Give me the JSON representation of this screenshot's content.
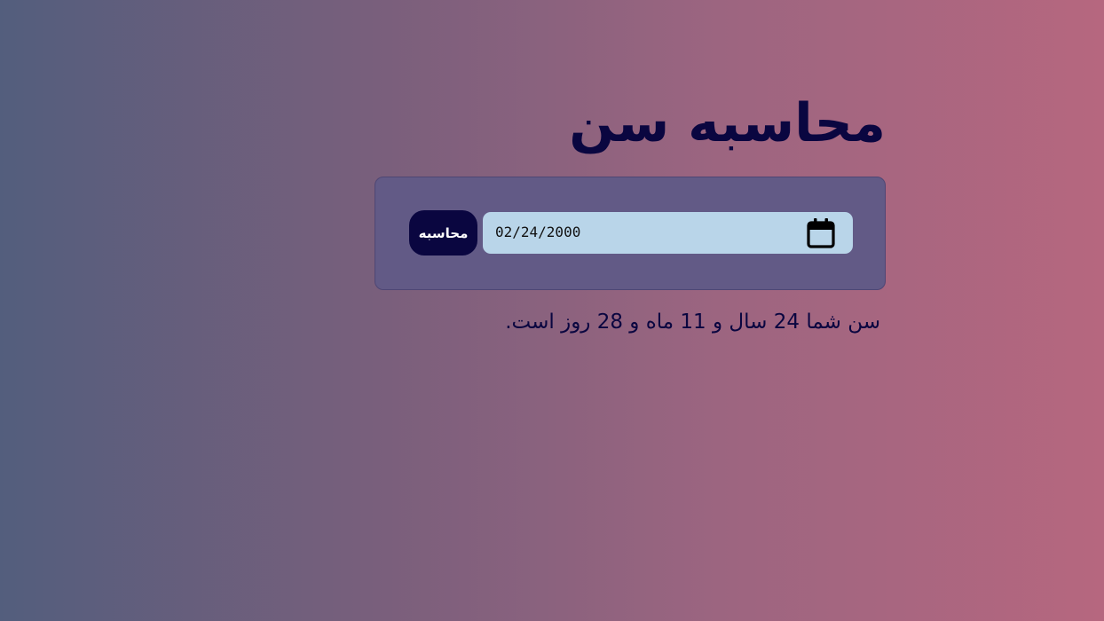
{
  "header": {
    "title": "محاسبه سن"
  },
  "form": {
    "date_value": "02/24/2000",
    "date_icon": "calendar-icon",
    "submit_label": "محاسبه"
  },
  "result": {
    "text": "سن شما 24 سال و 11 ماه و 28 روز است."
  },
  "colors": {
    "title_text": "#0a0640",
    "card_background": "#625a86",
    "input_background": "#b9d5e9",
    "button_background": "#0a0640",
    "button_text": "#ffffff",
    "gradient_start": "#535e7d",
    "gradient_end": "#b6677f"
  }
}
